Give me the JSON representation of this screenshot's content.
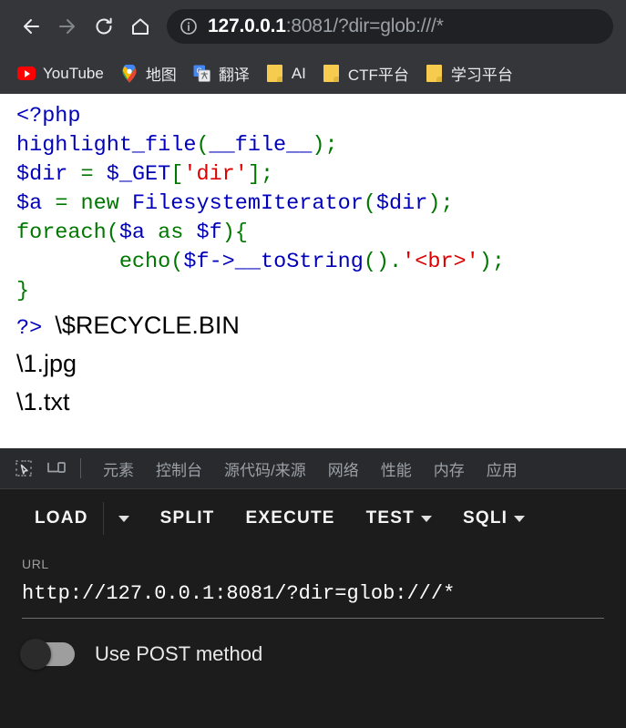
{
  "browser": {
    "nav": {
      "back_label": "Back",
      "forward_label": "Forward",
      "reload_label": "Reload",
      "home_label": "Home"
    },
    "omnibox": {
      "host": "127.0.0.1",
      "rest": ":8081/?dir=glob:///*",
      "full_url": "127.0.0.1:8081/?dir=glob:///*"
    },
    "bookmarks": [
      {
        "label": "YouTube",
        "icon": "youtube-icon"
      },
      {
        "label": "地图",
        "icon": "google-maps-icon"
      },
      {
        "label": "翻译",
        "icon": "google-translate-icon"
      },
      {
        "label": "AI",
        "icon": "folder-icon"
      },
      {
        "label": "CTF平台",
        "icon": "folder-icon"
      },
      {
        "label": "学习平台",
        "icon": "folder-icon"
      }
    ]
  },
  "page": {
    "code_lines": [
      {
        "tokens": [
          {
            "t": "<?php",
            "c": "c-tag"
          }
        ]
      },
      {
        "tokens": [
          {
            "t": "highlight_file",
            "c": "c-var"
          },
          {
            "t": "(",
            "c": "c-kw"
          },
          {
            "t": "__file__",
            "c": "c-var"
          },
          {
            "t": ")",
            "c": "c-kw"
          },
          {
            "t": ";",
            "c": "c-kw"
          }
        ]
      },
      {
        "tokens": [
          {
            "t": "$dir",
            "c": "c-var"
          },
          {
            "t": " = ",
            "c": "c-kw"
          },
          {
            "t": "$_GET",
            "c": "c-var"
          },
          {
            "t": "[",
            "c": "c-kw"
          },
          {
            "t": "'dir'",
            "c": "c-str"
          },
          {
            "t": "]",
            "c": "c-kw"
          },
          {
            "t": ";",
            "c": "c-kw"
          }
        ]
      },
      {
        "tokens": [
          {
            "t": "$a",
            "c": "c-var"
          },
          {
            "t": " = ",
            "c": "c-kw"
          },
          {
            "t": "new",
            "c": "c-kw"
          },
          {
            "t": " ",
            "c": "c-kw"
          },
          {
            "t": "FilesystemIterator",
            "c": "c-var"
          },
          {
            "t": "(",
            "c": "c-kw"
          },
          {
            "t": "$dir",
            "c": "c-var"
          },
          {
            "t": ")",
            "c": "c-kw"
          },
          {
            "t": ";",
            "c": "c-kw"
          }
        ]
      },
      {
        "tokens": [
          {
            "t": "foreach",
            "c": "c-kw"
          },
          {
            "t": "(",
            "c": "c-kw"
          },
          {
            "t": "$a",
            "c": "c-var"
          },
          {
            "t": " ",
            "c": "c-kw"
          },
          {
            "t": "as",
            "c": "c-kw"
          },
          {
            "t": " ",
            "c": "c-kw"
          },
          {
            "t": "$f",
            "c": "c-var"
          },
          {
            "t": ")",
            "c": "c-kw"
          },
          {
            "t": "{",
            "c": "c-kw"
          }
        ]
      },
      {
        "tokens": [
          {
            "t": "        ",
            "c": "c-kw"
          },
          {
            "t": "echo",
            "c": "c-kw"
          },
          {
            "t": "(",
            "c": "c-kw"
          },
          {
            "t": "$f",
            "c": "c-var"
          },
          {
            "t": "->__toString",
            "c": "c-var"
          },
          {
            "t": "()",
            "c": "c-kw"
          },
          {
            "t": ".",
            "c": "c-kw"
          },
          {
            "t": "'<br>'",
            "c": "c-str"
          },
          {
            "t": ")",
            "c": "c-kw"
          },
          {
            "t": ";",
            "c": "c-kw"
          }
        ]
      },
      {
        "tokens": [
          {
            "t": "}",
            "c": "c-kw"
          }
        ]
      }
    ],
    "close_tag": "?> ",
    "output_lines": [
      "\\$RECYCLE.BIN",
      "\\1.jpg",
      "\\1.txt"
    ]
  },
  "devtools": {
    "icons": [
      {
        "name": "inspect-element-icon"
      },
      {
        "name": "device-toolbar-icon"
      }
    ],
    "tabs": [
      "元素",
      "控制台",
      "源代码/来源",
      "网络",
      "性能",
      "内存",
      "应用"
    ]
  },
  "hackbar": {
    "buttons": [
      {
        "label": "LOAD",
        "caret": true
      },
      {
        "label": "SPLIT",
        "caret": false
      },
      {
        "label": "EXECUTE",
        "caret": false
      },
      {
        "label": "TEST",
        "caret": true
      },
      {
        "label": "SQLI",
        "caret": true
      }
    ],
    "url_label": "URL",
    "url_value": "http://127.0.0.1:8081/?dir=glob:///*",
    "post_toggle_label": "Use POST method",
    "post_toggle_state": "off"
  },
  "colors": {
    "chrome_bg": "#35363a",
    "omnibox_bg": "#202124",
    "devtools_bg": "#202124",
    "devtools_tabbar_bg": "#292a2d",
    "hackbar_bg": "#1c1c1c",
    "php_tag": "#0000bb",
    "php_keyword": "#007700",
    "php_string": "#dd0000",
    "youtube_red": "#ff0000",
    "folder_yellow": "#f7cb4d"
  }
}
